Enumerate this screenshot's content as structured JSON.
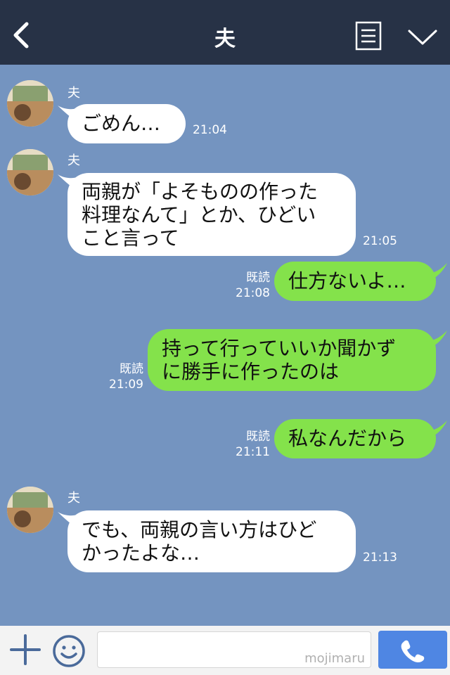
{
  "header": {
    "title": "夫"
  },
  "messages": [
    {
      "sender": "夫",
      "lines": [
        "ごめん…"
      ],
      "time": "21:04"
    },
    {
      "sender": "夫",
      "lines": [
        "両親が「よそものの作った",
        "料理なんて」とか、ひどい",
        "こと言って"
      ],
      "time": "21:05"
    },
    {
      "read": "既読",
      "lines": [
        "仕方ないよ…"
      ],
      "time": "21:08"
    },
    {
      "read": "既読",
      "lines": [
        "持って行っていいか聞かず",
        "に勝手に作ったのは"
      ],
      "time": "21:09"
    },
    {
      "read": "既読",
      "lines": [
        "私なんだから"
      ],
      "time": "21:11"
    },
    {
      "sender": "夫",
      "lines": [
        "でも、両親の言い方はひど",
        "かったよな…"
      ],
      "time": "21:13"
    }
  ],
  "input": {
    "value": "",
    "watermark": "mojimaru"
  },
  "colors": {
    "header_bg": "#273246",
    "chat_bg": "#7494c0",
    "outgoing_bubble": "#84e24b",
    "incoming_bubble": "#ffffff",
    "send_button": "#4f86e3"
  },
  "icons": [
    "back-icon",
    "menu-icon",
    "chevron-down-icon",
    "plus-icon",
    "smiley-icon",
    "phone-icon"
  ]
}
